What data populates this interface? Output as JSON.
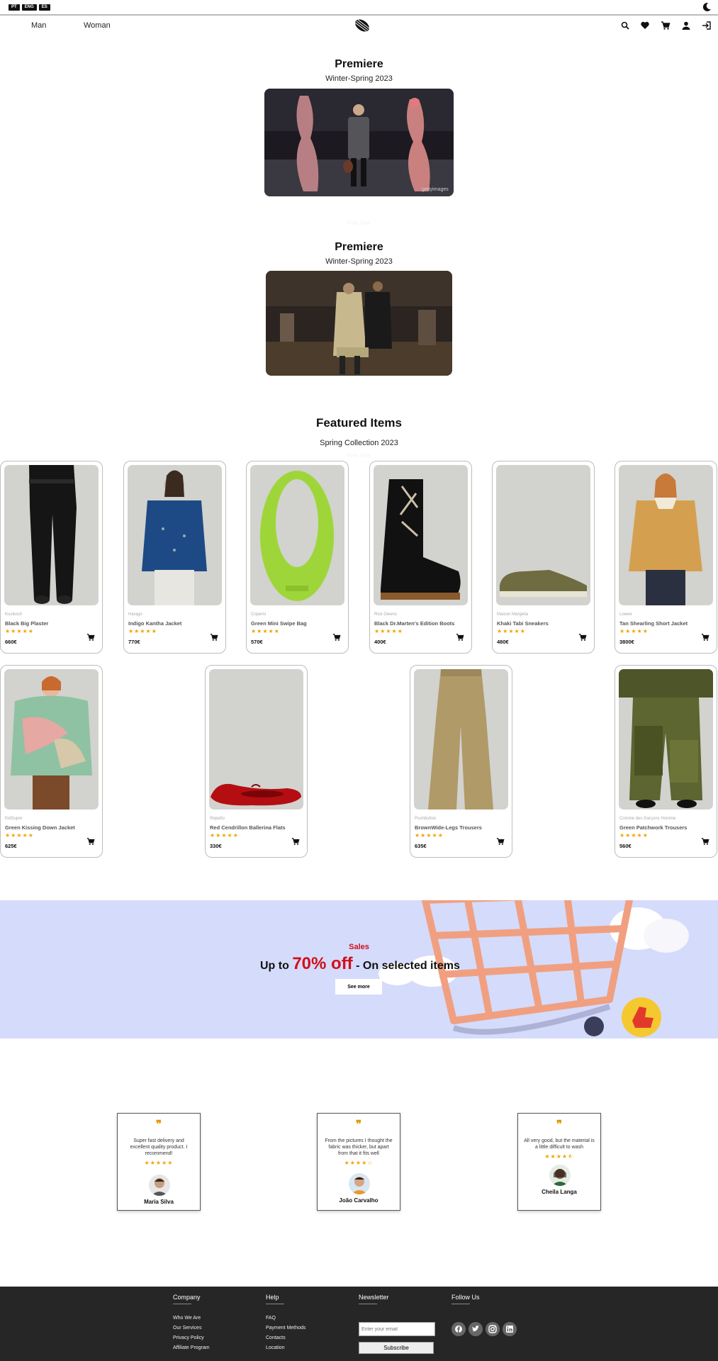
{
  "languages": [
    "PT",
    "ENG",
    "ES"
  ],
  "nav": {
    "man": "Man",
    "woman": "Woman"
  },
  "premiere1": {
    "title": "Premiere",
    "subtitle": "Winter-Spring 2023",
    "watermark": "gettyimages"
  },
  "ghost1": "Fine One",
  "premiere2": {
    "title": "Premiere",
    "subtitle": "Winter-Spring 2023"
  },
  "featured": {
    "title": "Featured Items",
    "subtitle": "Spring Collection 2023",
    "ghost": "Fine One"
  },
  "products": [
    {
      "brand": "Kusikoch",
      "name": "Black Big Plaster",
      "price": "660€",
      "rating": 5,
      "stars": "★★★★★"
    },
    {
      "brand": "Harago",
      "name": "Indigo Kantha Jacket",
      "price": "770€",
      "rating": 5,
      "stars": "★★★★★"
    },
    {
      "brand": "Coperni",
      "name": "Green Mini Swipe Bag",
      "price": "570€",
      "rating": 5,
      "stars": "★★★★★"
    },
    {
      "brand": "Rick Owens",
      "name": "Black Dr.Marten's Edition Boots",
      "price": "400€",
      "rating": 5,
      "stars": "★★★★★"
    },
    {
      "brand": "Maison Margiela",
      "name": "Khaki Tabi Sneakers",
      "price": "480€",
      "rating": 5,
      "stars": "★★★★★"
    },
    {
      "brand": "Loewe",
      "name": "Tan Shearling Short Jacket",
      "price": "3800€",
      "rating": 5,
      "stars": "★★★★★"
    },
    {
      "brand": "KidSuper",
      "name": "Green Kissing Down Jacket",
      "price": "625€",
      "rating": 5,
      "stars": "★★★★★"
    },
    {
      "brand": "Repetto",
      "name": "Red Cendrillon Ballerina Flats",
      "price": "330€",
      "rating": 5,
      "stars": "★★★★★"
    },
    {
      "brand": "Pushbutton",
      "name": "BrownWide-Legs Trousers",
      "price": "635€",
      "rating": 5,
      "stars": "★★★★★"
    },
    {
      "brand": "Comme des Garçons Homme",
      "name": "Green Patchwork Trousers",
      "price": "560€",
      "rating": 5,
      "stars": "★★★★★"
    }
  ],
  "sales": {
    "label": "Sales",
    "prefix": "Up to ",
    "percent": "70% off",
    "suffix": " - On selected items",
    "button": "See more"
  },
  "testimonials": [
    {
      "text": "Super fast delivery and excellent quality product. I recommend!",
      "rating": 5,
      "stars": "★★★★★",
      "name": "Maria Silva"
    },
    {
      "text": "From the pictures I thought the fabric was thicker, but apart from that it fits well",
      "rating": 4,
      "stars": "★★★★☆",
      "name": "João Carvalho"
    },
    {
      "text": "All very good, but the material is a little difficult to wash",
      "rating": 4.5,
      "stars": "★★★★⯪",
      "name": "Cheila Langa"
    }
  ],
  "footer": {
    "company": {
      "title": "Company",
      "links": [
        "Who We Are",
        "Our Services",
        "Privacy Policy",
        "Affiliate Program"
      ]
    },
    "help": {
      "title": "Help",
      "links": [
        "FAQ",
        "Payment Methods",
        "Contacts",
        "Location"
      ]
    },
    "newsletter": {
      "title": "Newsletter",
      "placeholder": "Enter your email",
      "button": "Subscribe"
    },
    "follow": {
      "title": "Follow Us",
      "icons": [
        "facebook-icon",
        "twitter-icon",
        "instagram-icon",
        "linkedin-icon"
      ]
    }
  },
  "colors": {
    "accent_red": "#d0101a",
    "star": "#f0a500",
    "banner_bg": "#d5dbfb",
    "footer_bg": "#262626"
  }
}
